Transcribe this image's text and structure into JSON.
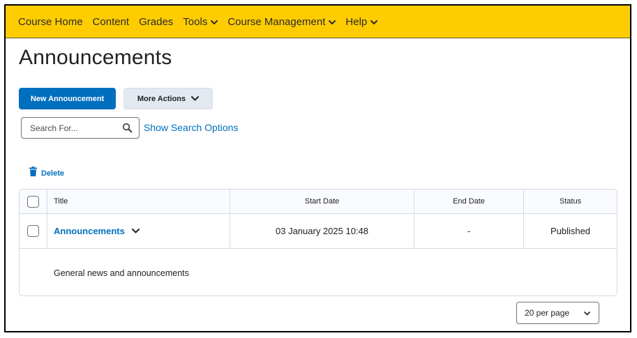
{
  "nav": {
    "items": [
      {
        "label": "Course Home",
        "dropdown": false
      },
      {
        "label": "Content",
        "dropdown": false
      },
      {
        "label": "Grades",
        "dropdown": false
      },
      {
        "label": "Tools",
        "dropdown": true
      },
      {
        "label": "Course Management",
        "dropdown": true
      },
      {
        "label": "Help",
        "dropdown": true
      }
    ],
    "color": "#ffcc00"
  },
  "page": {
    "title": "Announcements"
  },
  "toolbar": {
    "new_label": "New Announcement",
    "more_label": "More Actions"
  },
  "search": {
    "placeholder": "Search For...",
    "options_label": "Show Search Options"
  },
  "actions": {
    "delete_label": "Delete"
  },
  "table": {
    "headers": {
      "title": "Title",
      "start": "Start Date",
      "end": "End Date",
      "status": "Status"
    },
    "rows": [
      {
        "title": "Announcements",
        "start": "03 January 2025 10:48",
        "end": "-",
        "status": "Published",
        "description": "General news and announcements"
      }
    ]
  },
  "pagination": {
    "per_page": "20 per page"
  },
  "colors": {
    "accent": "#006fbf",
    "nav_bar": "#ffcc00"
  }
}
